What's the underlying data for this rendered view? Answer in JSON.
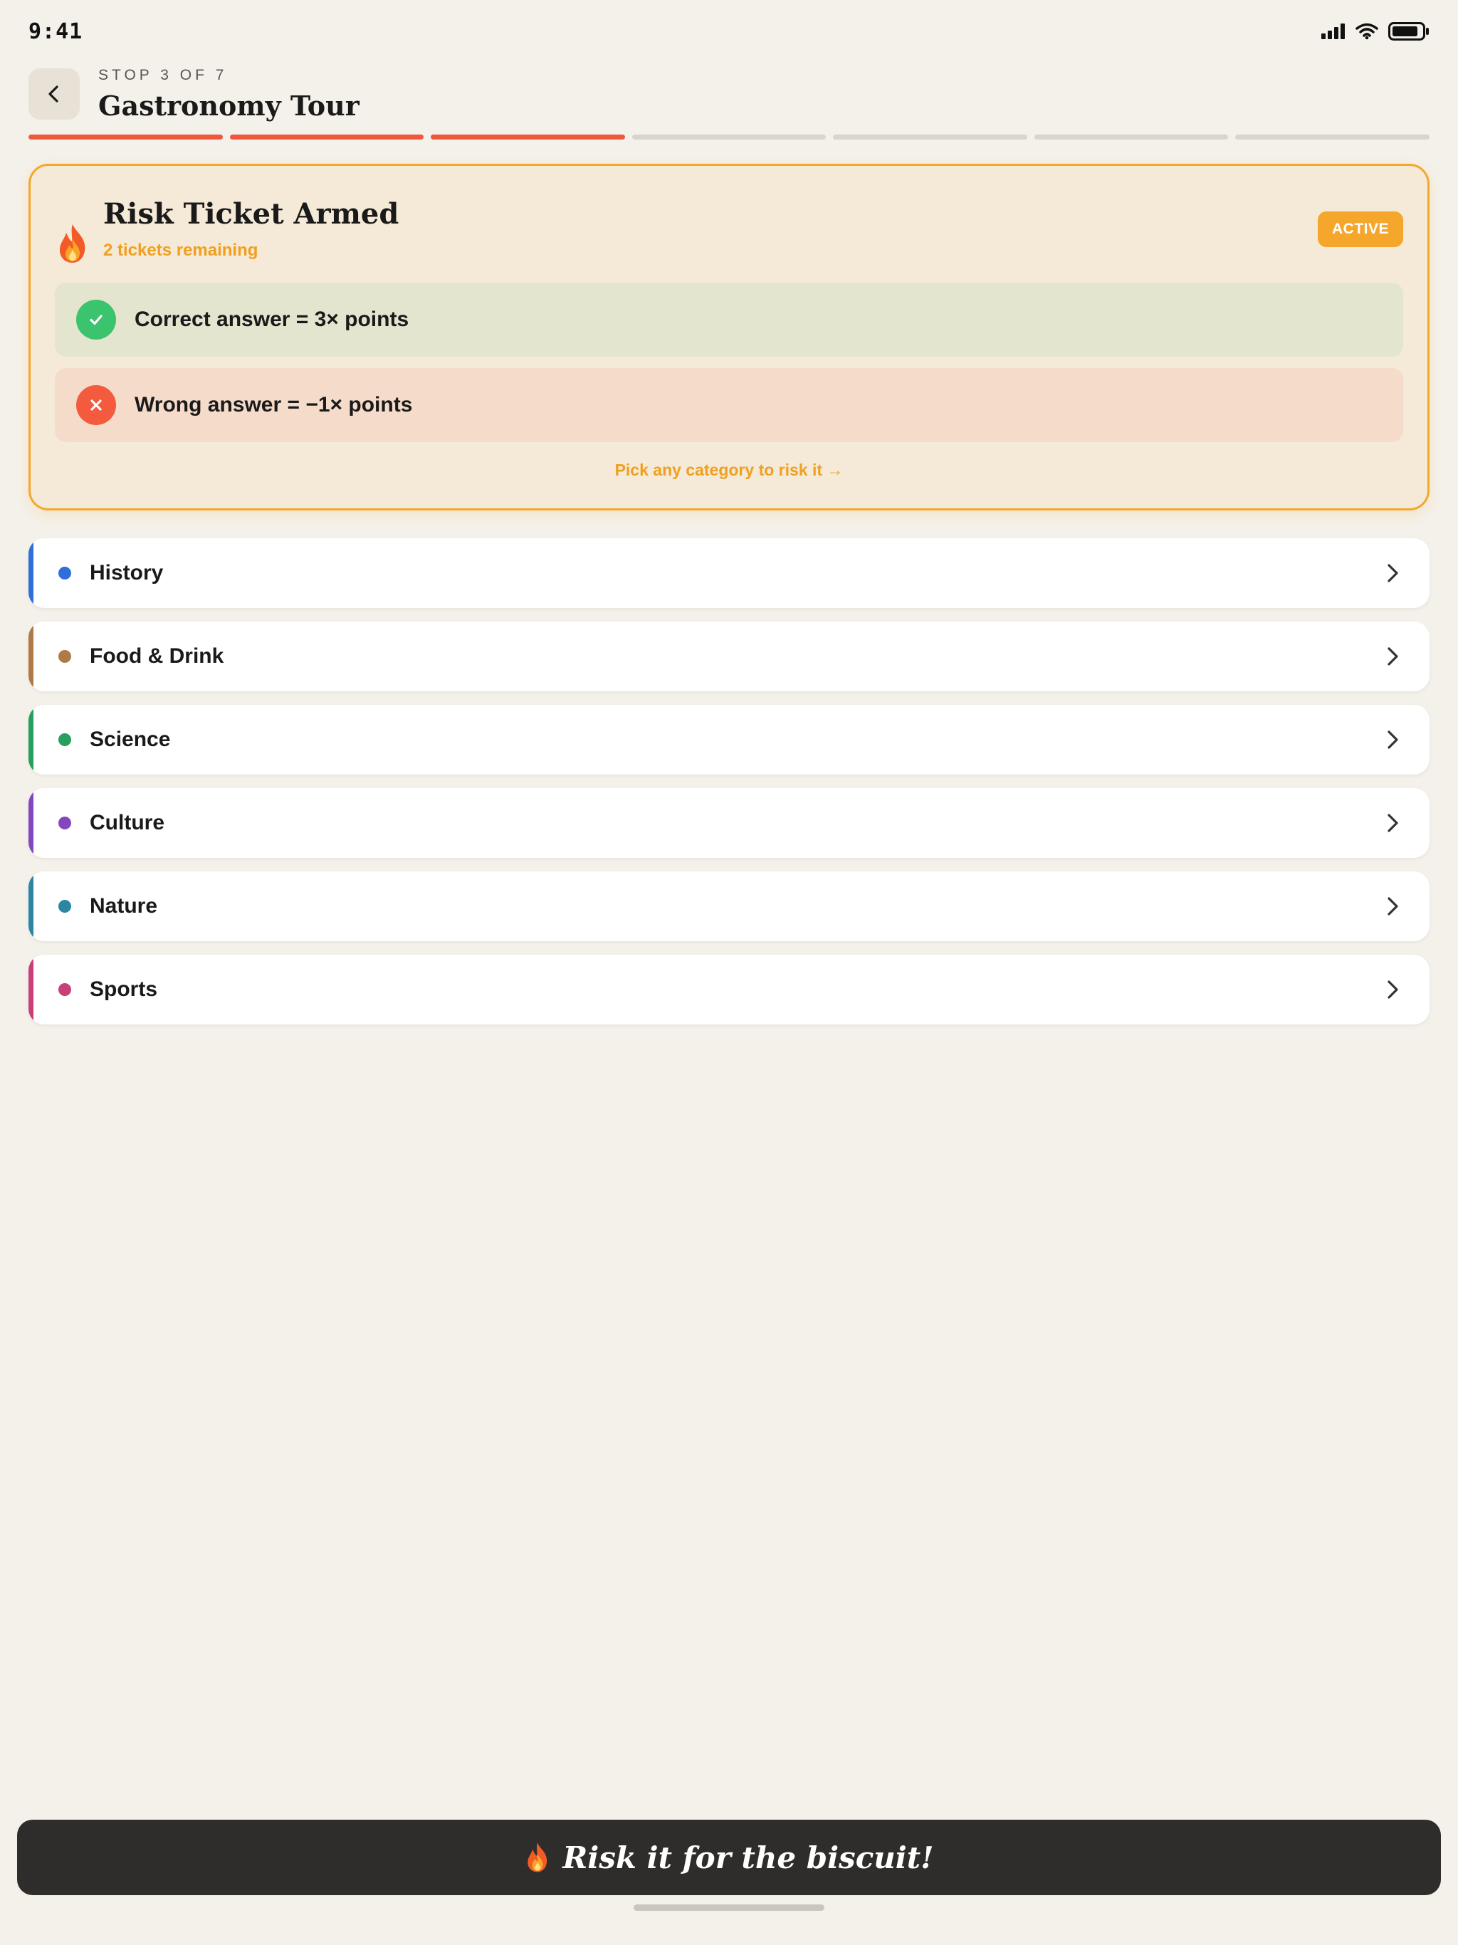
{
  "status_bar": {
    "time": "9:41",
    "icons": [
      "cellular-signal-icon",
      "wifi-icon",
      "battery-icon"
    ]
  },
  "header": {
    "back_icon": "chevron-left-icon",
    "stop_label": "STOP 3 OF 7",
    "title": "Gastronomy Tour"
  },
  "progress": {
    "current": 3,
    "total": 7,
    "done_color": "#F0573D",
    "pending_color": "#D8D5CF"
  },
  "risk_card": {
    "icon": "flame-icon",
    "title": "Risk Ticket Armed",
    "subtitle": "2 tickets remaining",
    "badge": "ACTIVE",
    "correct_rule": "Correct answer = 3× points",
    "wrong_rule": "Wrong answer = −1× points",
    "hint": "Pick any category to risk it →",
    "accent_color": "#F5A72B"
  },
  "categories": [
    {
      "label": "History",
      "color": "#2F6FDB"
    },
    {
      "label": "Food & Drink",
      "color": "#B07A47"
    },
    {
      "label": "Science",
      "color": "#26A05C"
    },
    {
      "label": "Culture",
      "color": "#8446BE"
    },
    {
      "label": "Nature",
      "color": "#2C86A3"
    },
    {
      "label": "Sports",
      "color": "#C93F78"
    }
  ],
  "cta": {
    "icon": "flame-icon",
    "label": "Risk it for the biscuit!"
  }
}
